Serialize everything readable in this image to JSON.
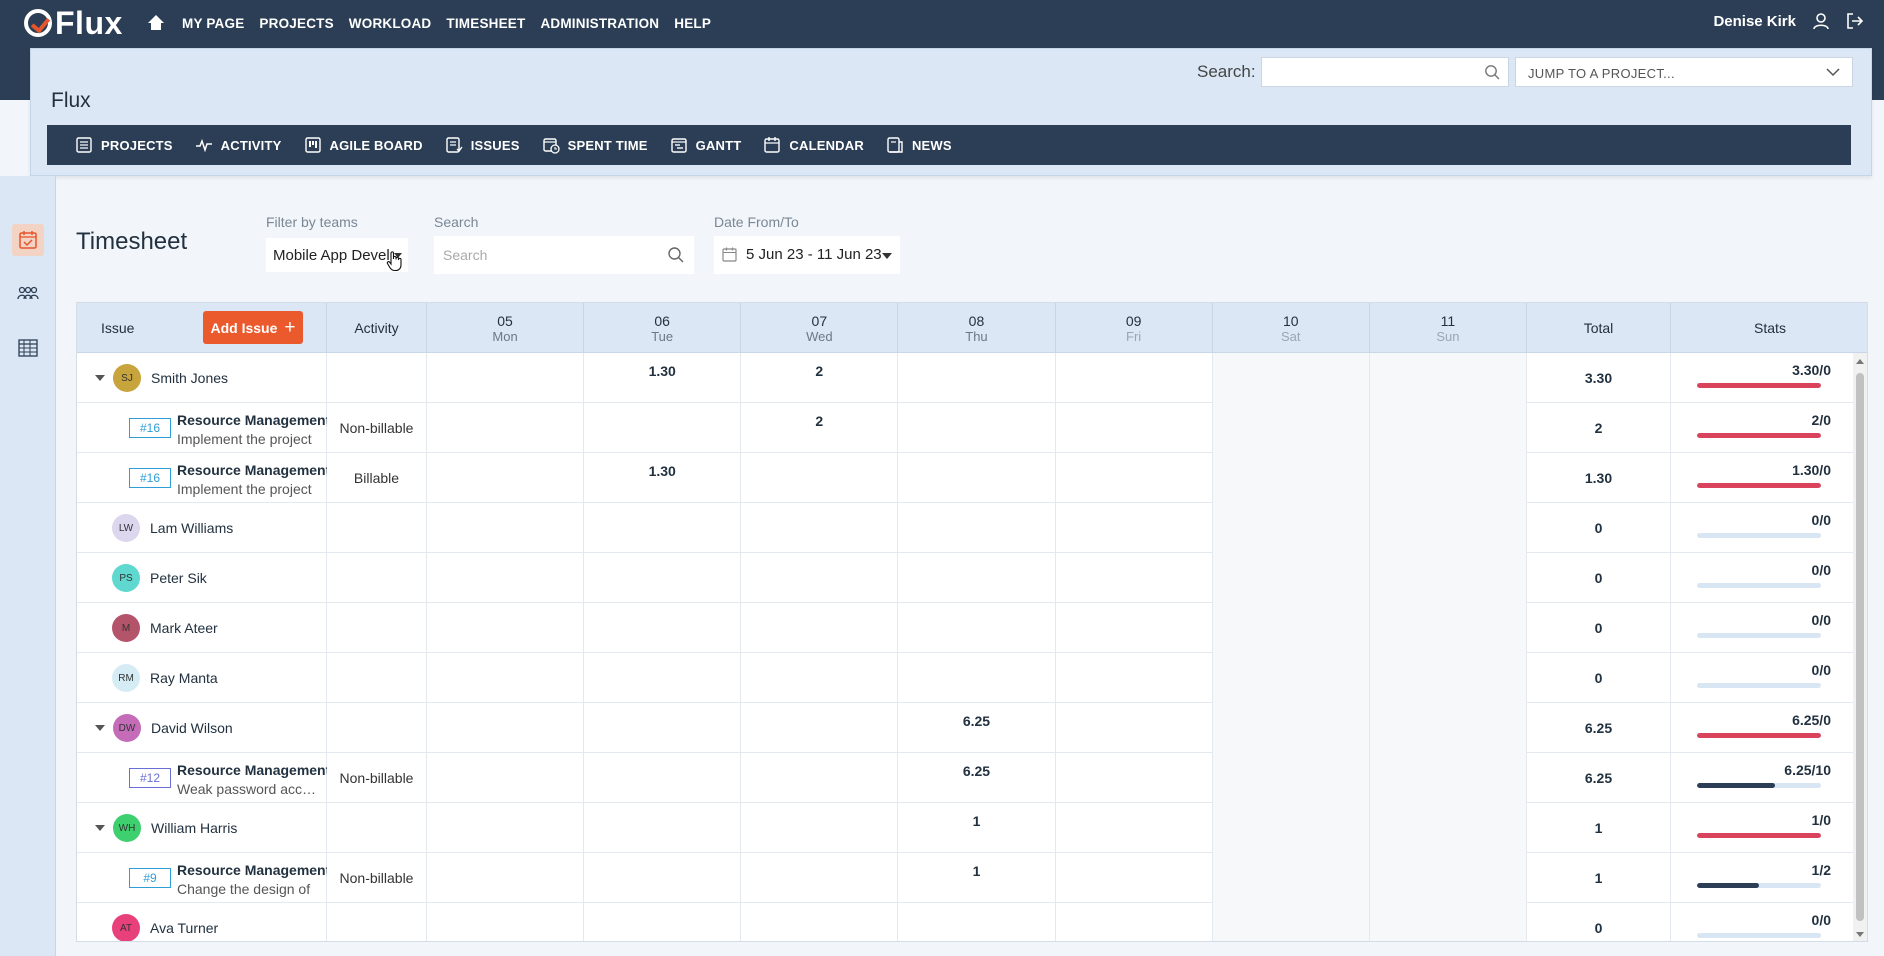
{
  "app": {
    "logo_text": "Flux"
  },
  "topnav": {
    "items": [
      "MY PAGE",
      "PROJECTS",
      "WORKLOAD",
      "TIMESHEET",
      "ADMINISTRATION",
      "HELP"
    ],
    "user_name": "Denise Kirk"
  },
  "project": {
    "title": "Flux",
    "search_label": "Search:",
    "search_value": "",
    "jump_placeholder": "JUMP TO A PROJECT...",
    "modules": [
      "PROJECTS",
      "ACTIVITY",
      "AGILE BOARD",
      "ISSUES",
      "SPENT TIME",
      "GANTT",
      "CALENDAR",
      "NEWS"
    ]
  },
  "timesheet": {
    "title": "Timesheet",
    "filter_label": "Filter by teams",
    "filter_value": "Mobile App Devel",
    "search_label": "Search",
    "search_placeholder": "Search",
    "date_label": "Date From/To",
    "date_value": "5 Jun 23 - 11 Jun 23"
  },
  "table": {
    "headers": {
      "issue": "Issue",
      "add_issue": "Add Issue",
      "activity": "Activity",
      "total": "Total",
      "stats": "Stats"
    },
    "days": [
      {
        "num": "05",
        "name": "Mon"
      },
      {
        "num": "06",
        "name": "Tue"
      },
      {
        "num": "07",
        "name": "Wed"
      },
      {
        "num": "08",
        "name": "Thu"
      },
      {
        "num": "09",
        "name": "Fri"
      },
      {
        "num": "10",
        "name": "Sat"
      },
      {
        "num": "11",
        "name": "Sun"
      }
    ],
    "rows": [
      {
        "type": "person",
        "initials": "SJ",
        "name": "Smith Jones",
        "expandable": true,
        "avatar_color": "#c7a43c",
        "days": [
          "",
          "1.30",
          "2",
          "",
          "",
          "",
          ""
        ],
        "total": "3.30",
        "stat": "3.30/0",
        "stat_fraction": 1.0,
        "stat_color": "#d9435b"
      },
      {
        "type": "issue",
        "tag": "#16",
        "tag_style": "blue",
        "title": "Resource Management",
        "subtitle": "Implement the project",
        "activity": "Non-billable",
        "days": [
          "",
          "",
          "2",
          "",
          "",
          "",
          ""
        ],
        "total": "2",
        "stat": "2/0",
        "stat_fraction": 1.0,
        "stat_color": "#d9435b"
      },
      {
        "type": "issue",
        "tag": "#16",
        "tag_style": "blue",
        "title": "Resource Management",
        "subtitle": "Implement the project",
        "activity": "Billable",
        "days": [
          "",
          "1.30",
          "",
          "",
          "",
          "",
          ""
        ],
        "total": "1.30",
        "stat": "1.30/0",
        "stat_fraction": 1.0,
        "stat_color": "#d9435b"
      },
      {
        "type": "person",
        "initials": "LW",
        "name": "Lam Williams",
        "expandable": false,
        "avatar_color": "#dcd6ee",
        "days": [
          "",
          "",
          "",
          "",
          "",
          "",
          ""
        ],
        "total": "0",
        "stat": "0/0",
        "stat_fraction": 0,
        "stat_color": "#d9435b"
      },
      {
        "type": "person",
        "initials": "PS",
        "name": "Peter Sik",
        "expandable": false,
        "avatar_color": "#5fd8d0",
        "days": [
          "",
          "",
          "",
          "",
          "",
          "",
          ""
        ],
        "total": "0",
        "stat": "0/0",
        "stat_fraction": 0,
        "stat_color": "#d9435b"
      },
      {
        "type": "person",
        "initials": "M",
        "name": "Mark Ateer",
        "expandable": false,
        "avatar_color": "#b4546a",
        "days": [
          "",
          "",
          "",
          "",
          "",
          "",
          ""
        ],
        "total": "0",
        "stat": "0/0",
        "stat_fraction": 0,
        "stat_color": "#d9435b"
      },
      {
        "type": "person",
        "initials": "RM",
        "name": "Ray Manta",
        "expandable": false,
        "avatar_color": "#d6ecf5",
        "days": [
          "",
          "",
          "",
          "",
          "",
          "",
          ""
        ],
        "total": "0",
        "stat": "0/0",
        "stat_fraction": 0,
        "stat_color": "#d9435b"
      },
      {
        "type": "person",
        "initials": "DW",
        "name": "David Wilson",
        "expandable": true,
        "avatar_color": "#c46cb8",
        "days": [
          "",
          "",
          "",
          "6.25",
          "",
          "",
          ""
        ],
        "total": "6.25",
        "stat": "6.25/0",
        "stat_fraction": 1.0,
        "stat_color": "#d9435b"
      },
      {
        "type": "issue",
        "tag": "#12",
        "tag_style": "purple",
        "title": "Resource Management",
        "subtitle": "Weak password access",
        "activity": "Non-billable",
        "days": [
          "",
          "",
          "",
          "6.25",
          "",
          "",
          ""
        ],
        "total": "6.25",
        "stat": "6.25/10",
        "stat_fraction": 0.625,
        "stat_color": "#2c3e55"
      },
      {
        "type": "person",
        "initials": "WH",
        "name": "William Harris",
        "expandable": true,
        "avatar_color": "#3ecf6e",
        "days": [
          "",
          "",
          "",
          "1",
          "",
          "",
          ""
        ],
        "total": "1",
        "stat": "1/0",
        "stat_fraction": 1.0,
        "stat_color": "#d9435b"
      },
      {
        "type": "issue",
        "tag": "#9",
        "tag_style": "blue",
        "title": "Resource Management",
        "subtitle": "Change the design of",
        "activity": "Non-billable",
        "days": [
          "",
          "",
          "",
          "1",
          "",
          "",
          ""
        ],
        "total": "1",
        "stat": "1/2",
        "stat_fraction": 0.5,
        "stat_color": "#2c3e55"
      },
      {
        "type": "person",
        "initials": "AT",
        "name": "Ava Turner",
        "expandable": false,
        "avatar_color": "#e8407a",
        "days": [
          "",
          "",
          "",
          "",
          "",
          "",
          ""
        ],
        "total": "0",
        "stat": "0/0",
        "stat_fraction": 0,
        "stat_color": "#d9435b"
      }
    ]
  }
}
